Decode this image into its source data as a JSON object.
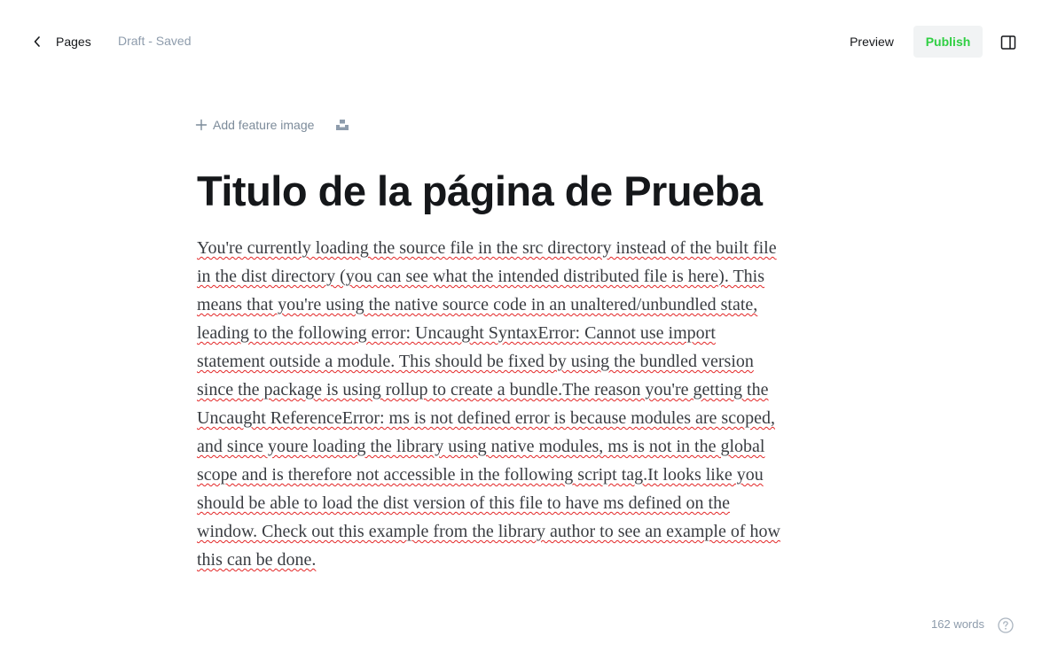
{
  "header": {
    "back_label": "Pages",
    "status": "Draft - Saved",
    "preview_label": "Preview",
    "publish_label": "Publish"
  },
  "feature_image": {
    "add_label": "Add feature image"
  },
  "post": {
    "title": "Titulo de la página de Prueba",
    "body_lines": [
      "You're currently loading the source file in the src directory instead of the built file",
      "in the dist directory (you can see what the intended distributed file is here). This",
      "means that you're using the native source code in an unaltered/unbundled state,",
      "leading to the following error: Uncaught SyntaxError: Cannot use import",
      "statement outside a module. This should be fixed by using the bundled version",
      "since the package is using rollup to create a bundle.The reason you're getting the",
      "Uncaught ReferenceError: ms is not defined error is because modules are scoped,",
      "and since youre loading the library using native modules, ms is not in the global",
      "scope and is therefore not accessible in the following script tag.It looks like you",
      "should be able to load the dist version of this file to have ms defined on the",
      "window. Check out this example from the library author to see an example of how",
      "this can be done."
    ]
  },
  "footer": {
    "word_count": "162 words"
  },
  "icons": {
    "back": "chevron-left-icon",
    "sidebar": "sidebar-toggle-icon",
    "add": "plus-icon",
    "unsplash": "unsplash-icon",
    "help": "help-circle-icon"
  },
  "colors": {
    "publish_text": "#30cf43",
    "publish_bg": "#f1f3f4",
    "muted_text": "#8e9cac",
    "spellcheck_underline": "#e32626"
  }
}
